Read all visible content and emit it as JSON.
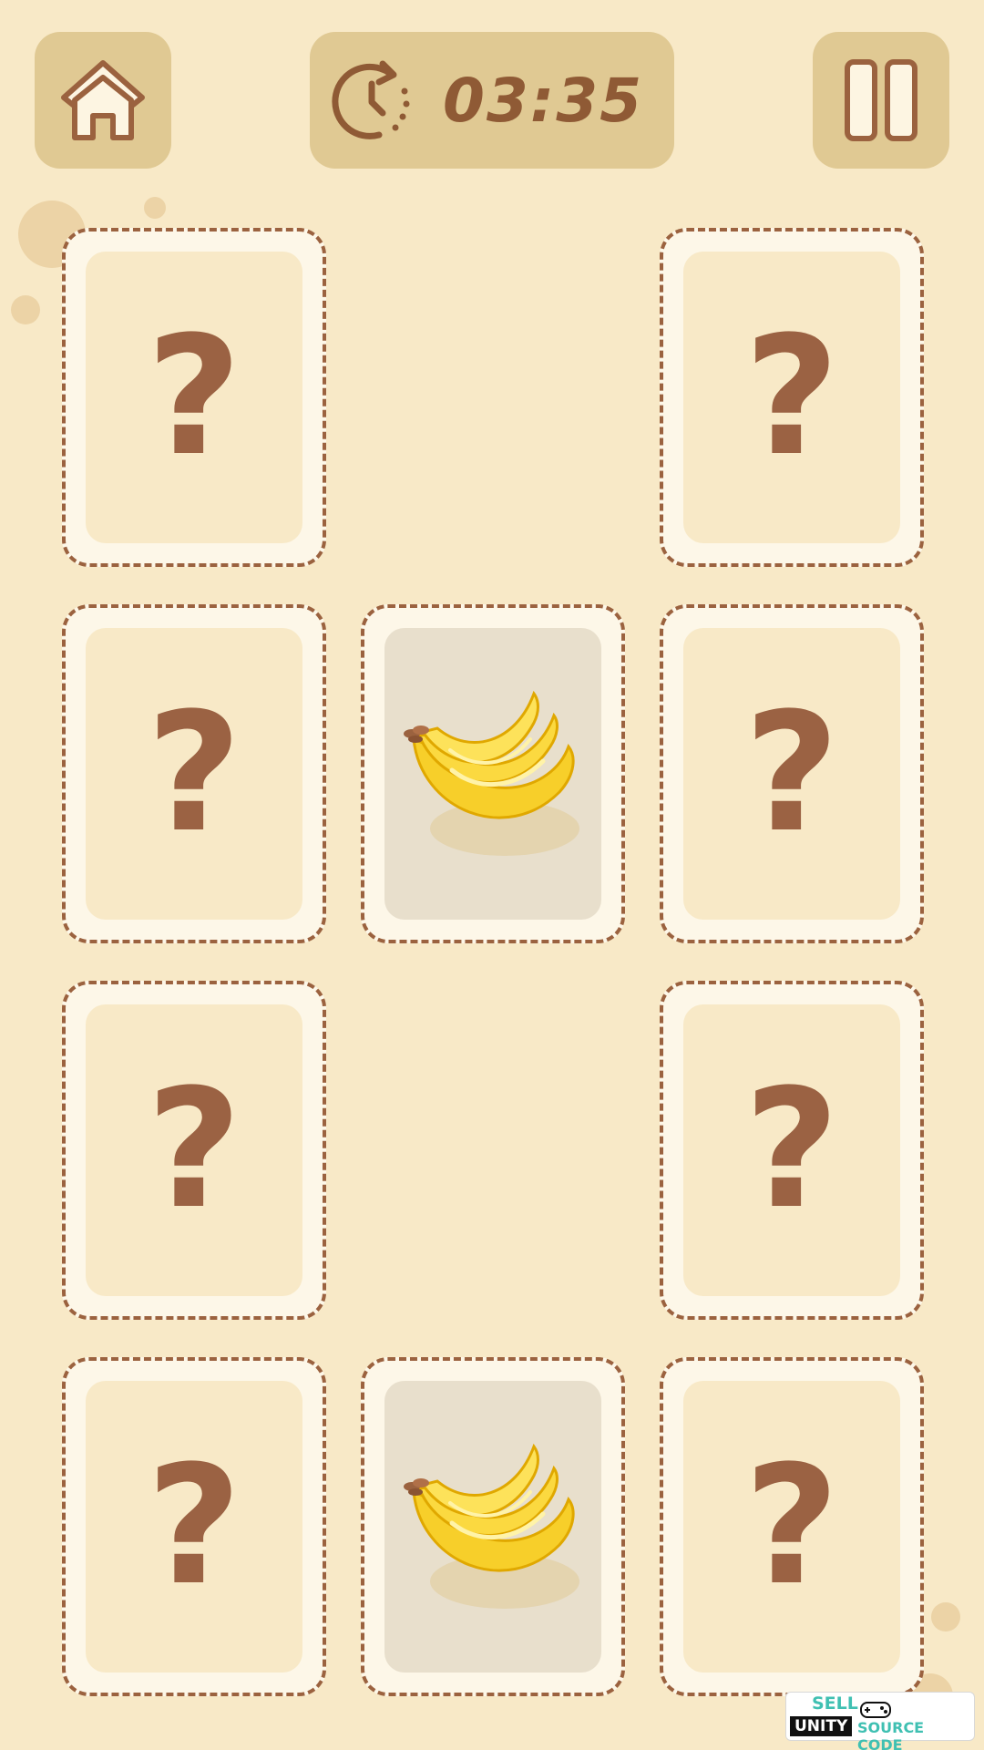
{
  "timer": {
    "value": "03:35",
    "icon": "timer-clock-icon"
  },
  "buttons": {
    "home_icon": "home-icon",
    "pause_icon": "pause-icon"
  },
  "cards": [
    {
      "row": 0,
      "col": 0,
      "state": "hidden",
      "face": "?"
    },
    {
      "row": 0,
      "col": 2,
      "state": "hidden",
      "face": "?"
    },
    {
      "row": 1,
      "col": 0,
      "state": "hidden",
      "face": "?"
    },
    {
      "row": 1,
      "col": 1,
      "state": "revealed",
      "face": "banana"
    },
    {
      "row": 1,
      "col": 2,
      "state": "hidden",
      "face": "?"
    },
    {
      "row": 2,
      "col": 0,
      "state": "hidden",
      "face": "?"
    },
    {
      "row": 2,
      "col": 2,
      "state": "hidden",
      "face": "?"
    },
    {
      "row": 3,
      "col": 0,
      "state": "hidden",
      "face": "?"
    },
    {
      "row": 3,
      "col": 1,
      "state": "revealed",
      "face": "banana"
    },
    {
      "row": 3,
      "col": 2,
      "state": "hidden",
      "face": "?"
    }
  ],
  "watermark": {
    "line1": "SELL",
    "line2a": "UNITY",
    "line2b": "SOURCE CODE"
  },
  "colors": {
    "background": "#f8e9c7",
    "panel": "#e0c993",
    "brown": "#9b623f",
    "banana": "#f7cf2a"
  }
}
